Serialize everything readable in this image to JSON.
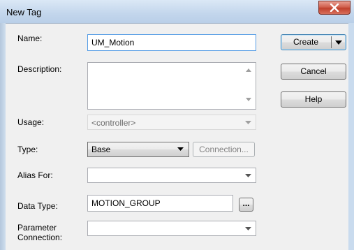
{
  "window": {
    "title": "New Tag"
  },
  "form": {
    "name_label": "Name:",
    "name_value": "UM_Motion",
    "description_label": "Description:",
    "description_value": "",
    "usage_label": "Usage:",
    "usage_value": "<controller>",
    "type_label": "Type:",
    "type_value": "Base",
    "connection_label": "Connection...",
    "alias_label": "Alias For:",
    "alias_value": "",
    "datatype_label": "Data Type:",
    "datatype_value": "MOTION_GROUP",
    "browse_label": "...",
    "param_label_line1": "Parameter",
    "param_label_line2": "Connection:",
    "param_value": ""
  },
  "buttons": {
    "create": "Create",
    "cancel": "Cancel",
    "help": "Help"
  },
  "icons": {
    "close": "close-icon",
    "dropdown": "chevron-down-icon"
  },
  "colors": {
    "title_bg": "#c3d6ec",
    "close_bg": "#c0402c",
    "dialog_bg": "#f0f0f0",
    "focus_border": "#569de5"
  }
}
